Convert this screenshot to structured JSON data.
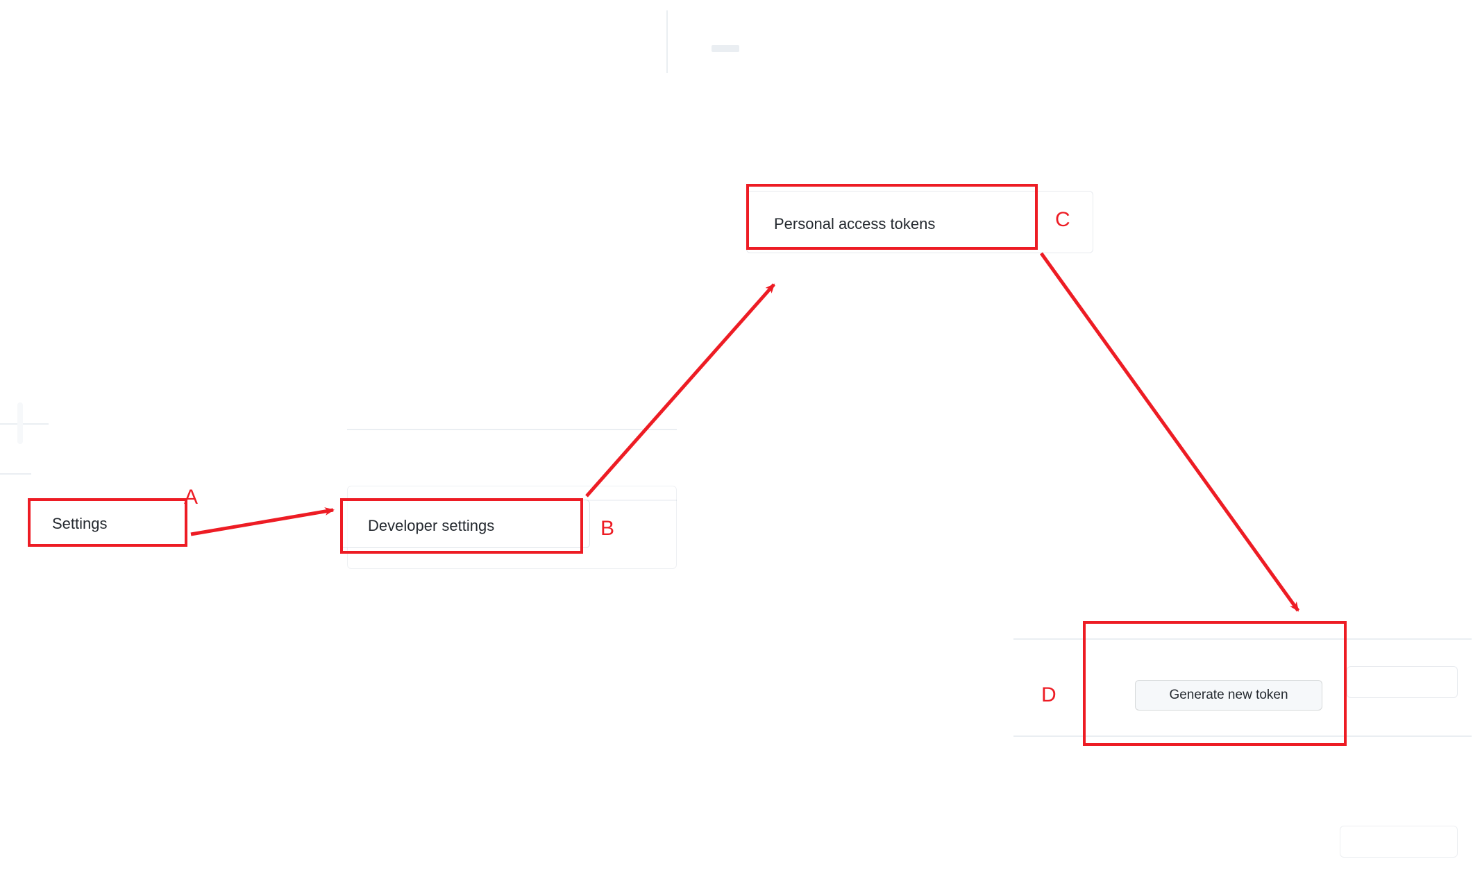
{
  "steps": {
    "a": {
      "label": "A",
      "text": "Settings"
    },
    "b": {
      "label": "B",
      "text": "Developer settings"
    },
    "c": {
      "label": "C",
      "text": "Personal access tokens"
    },
    "d": {
      "label": "D",
      "text": "Generate new token"
    }
  },
  "annotation_color": "#ed1c24"
}
